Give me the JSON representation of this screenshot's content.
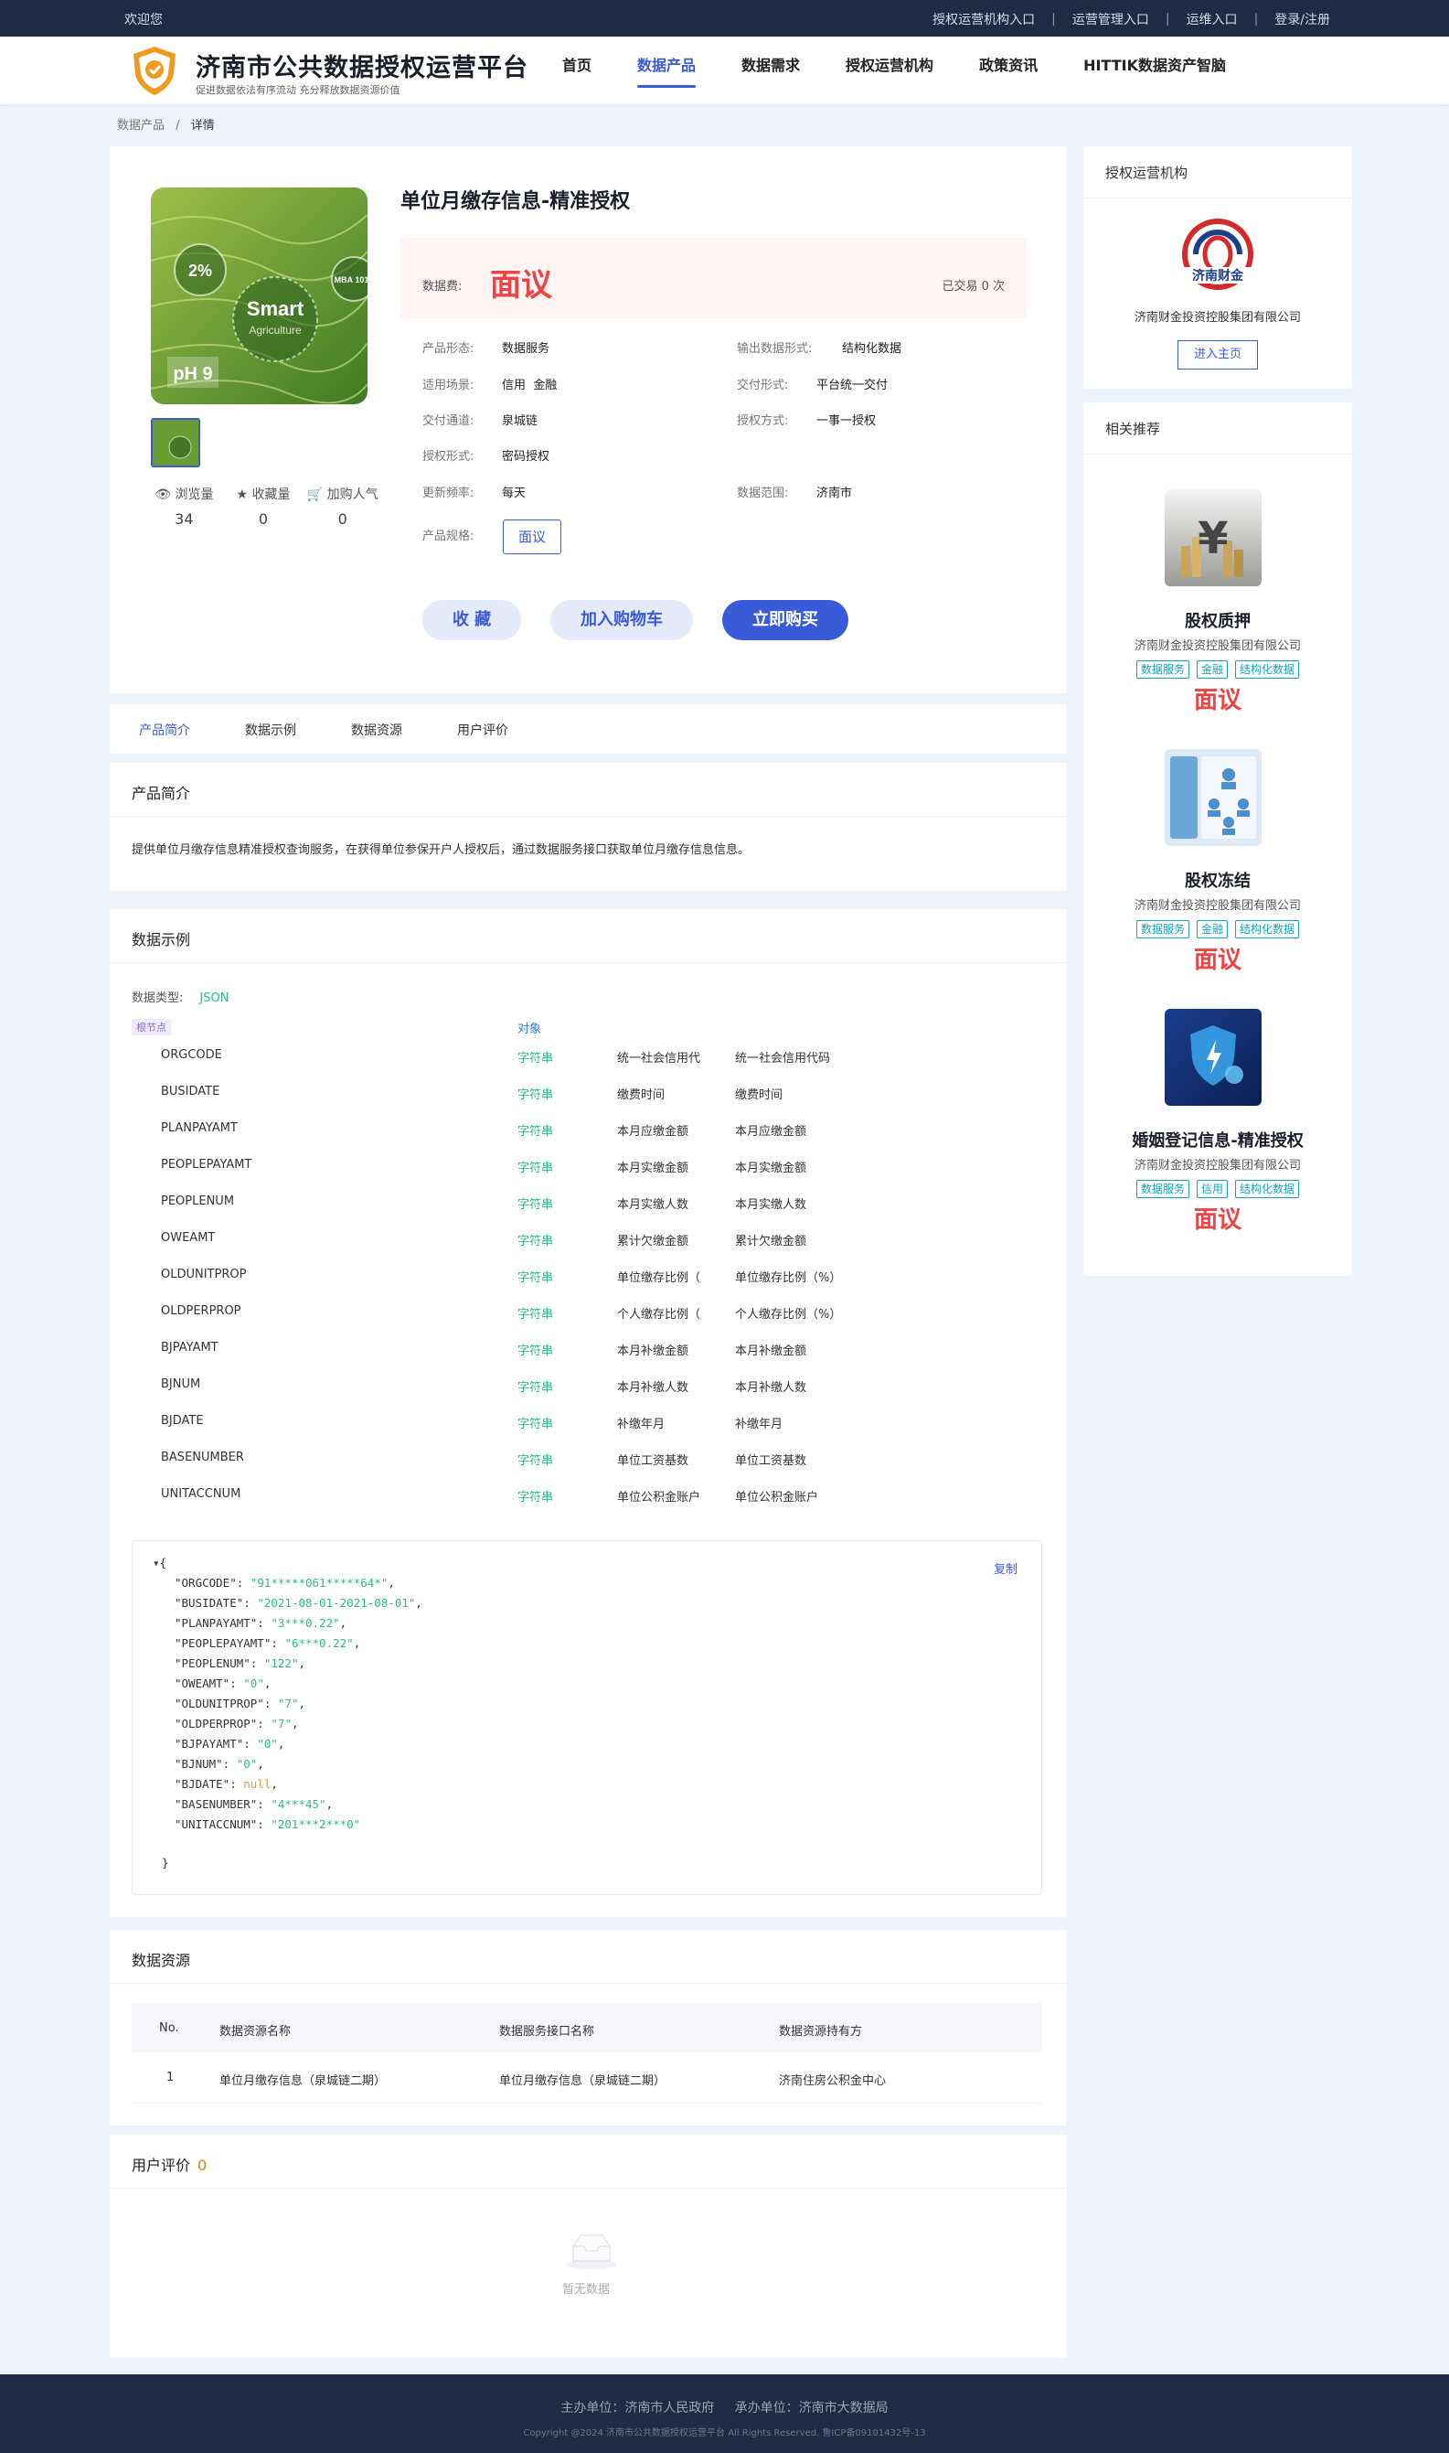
{
  "topbar": {
    "welcome": "欢迎您",
    "links": [
      "授权运营机构入口",
      "运营管理入口",
      "运维入口",
      "登录/注册"
    ]
  },
  "header": {
    "title": "济南市公共数据授权运营平台",
    "subtitle": "促进数据依法有序流动 充分释放数据资源价值",
    "nav": [
      "首页",
      "数据产品",
      "数据需求",
      "授权运营机构",
      "政策资讯",
      "HITTIK数据资产智脑"
    ],
    "active_nav": "数据产品"
  },
  "breadcrumb": {
    "parent": "数据产品",
    "sep": "/",
    "current": "详情"
  },
  "product": {
    "image_texts": {
      "pct": "2%",
      "smart": "Smart",
      "agri": "Agriculture",
      "ph": "pH 9",
      "mba": "MBA 1010"
    },
    "title": "单位月缴存信息-精准授权",
    "price_label": "数据费:",
    "price": "面议",
    "traded": "已交易 0 次",
    "stats": [
      {
        "label": "浏览量",
        "value": "34",
        "icon": "eye-icon"
      },
      {
        "label": "收藏量",
        "value": "0",
        "icon": "star-icon"
      },
      {
        "label": "加购人气",
        "value": "0",
        "icon": "cart-icon"
      }
    ],
    "attrs": {
      "form_k": "产品形态:",
      "form_v": "数据服务",
      "output_k": "输出数据形式:",
      "output_v": "结构化数据",
      "scene_k": "适用场景:",
      "scene_v": "信用  金融",
      "delivery_k": "交付形式:",
      "delivery_v": "平台统一交付",
      "channel_k": "交付通道:",
      "channel_v": "泉城链",
      "auth_k": "授权方式:",
      "auth_v": "一事一授权",
      "authform_k": "授权形式:",
      "authform_v": "密码授权",
      "freq_k": "更新频率:",
      "freq_v": "每天",
      "range_k": "数据范围:",
      "range_v": "济南市",
      "spec_k": "产品规格:",
      "spec_v": "面议"
    },
    "buttons": {
      "fav": "收 藏",
      "cart": "加入购物车",
      "buy": "立即购买"
    }
  },
  "tabs": [
    "产品简介",
    "数据示例",
    "数据资源",
    "用户评价"
  ],
  "intro": {
    "title": "产品简介",
    "text": "提供单位月缴存信息精准授权查询服务，在获得单位参保开户人授权后，通过数据服务接口获取单位月缴存信息信息。"
  },
  "sample": {
    "title": "数据示例",
    "type_label": "数据类型:",
    "type_value": "JSON",
    "root_tag": "根节点",
    "object_label": "对象",
    "fields": [
      {
        "name": "ORGCODE",
        "type": "字符串",
        "desc1": "统一社会信用代",
        "desc2": "统一社会信用代码"
      },
      {
        "name": "BUSIDATE",
        "type": "字符串",
        "desc1": "缴费时间",
        "desc2": "缴费时间"
      },
      {
        "name": "PLANPAYAMT",
        "type": "字符串",
        "desc1": "本月应缴金额",
        "desc2": "本月应缴金额"
      },
      {
        "name": "PEOPLEPAYAMT",
        "type": "字符串",
        "desc1": "本月实缴金额",
        "desc2": "本月实缴金额"
      },
      {
        "name": "PEOPLENUM",
        "type": "字符串",
        "desc1": "本月实缴人数",
        "desc2": "本月实缴人数"
      },
      {
        "name": "OWEAMT",
        "type": "字符串",
        "desc1": "累计欠缴金额",
        "desc2": "累计欠缴金额"
      },
      {
        "name": "OLDUNITPROP",
        "type": "字符串",
        "desc1": "单位缴存比例（",
        "desc2": "单位缴存比例（%）"
      },
      {
        "name": "OLDPERPROP",
        "type": "字符串",
        "desc1": "个人缴存比例（",
        "desc2": "个人缴存比例（%）"
      },
      {
        "name": "BJPAYAMT",
        "type": "字符串",
        "desc1": "本月补缴金额",
        "desc2": "本月补缴金额"
      },
      {
        "name": "BJNUM",
        "type": "字符串",
        "desc1": "本月补缴人数",
        "desc2": "本月补缴人数"
      },
      {
        "name": "BJDATE",
        "type": "字符串",
        "desc1": "补缴年月",
        "desc2": "补缴年月"
      },
      {
        "name": "BASENUMBER",
        "type": "字符串",
        "desc1": "单位工资基数",
        "desc2": "单位工资基数"
      },
      {
        "name": "UNITACCNUM",
        "type": "字符串",
        "desc1": "单位公积金账户",
        "desc2": "单位公积金账户"
      }
    ],
    "copy_label": "复制",
    "json_open": "▾{",
    "json_close": "}",
    "json_lines": [
      {
        "key": "\"ORGCODE\": ",
        "val": "\"91*****061*****64*\"",
        "null": false
      },
      {
        "key": "\"BUSIDATE\": ",
        "val": "\"2021-08-01-2021-08-01\"",
        "null": false
      },
      {
        "key": "\"PLANPAYAMT\": ",
        "val": "\"3***0.22\"",
        "null": false
      },
      {
        "key": "\"PEOPLEPAYAMT\": ",
        "val": "\"6***0.22\"",
        "null": false
      },
      {
        "key": "\"PEOPLENUM\": ",
        "val": "\"122\"",
        "null": false
      },
      {
        "key": "\"OWEAMT\": ",
        "val": "\"0\"",
        "null": false
      },
      {
        "key": "\"OLDUNITPROP\": ",
        "val": "\"7\"",
        "null": false
      },
      {
        "key": "\"OLDPERPROP\": ",
        "val": "\"7\"",
        "null": false
      },
      {
        "key": "\"BJPAYAMT\": ",
        "val": "\"0\"",
        "null": false
      },
      {
        "key": "\"BJNUM\": ",
        "val": "\"0\"",
        "null": false
      },
      {
        "key": "\"BJDATE\": ",
        "val": "null",
        "null": true
      },
      {
        "key": "\"BASENUMBER\": ",
        "val": "\"4***45\"",
        "null": false
      },
      {
        "key": "\"UNITACCNUM\": ",
        "val": "\"201***2***0\"",
        "null": false
      }
    ]
  },
  "resources": {
    "title": "数据资源",
    "headers": [
      "No.",
      "数据资源名称",
      "数据服务接口名称",
      "数据资源持有方"
    ],
    "rows": [
      [
        "1",
        "单位月缴存信息（泉城链二期）",
        "单位月缴存信息（泉城链二期）",
        "济南住房公积金中心"
      ]
    ]
  },
  "evaluation": {
    "title": "用户评价",
    "count": "0",
    "empty": "暂无数据"
  },
  "side_org": {
    "title": "授权运营机构",
    "logo_text": "济南财金",
    "name": "济南财金投资控股集团有限公司",
    "button": "进入主页"
  },
  "side_rec": {
    "title": "相关推荐",
    "items": [
      {
        "name": "股权质押",
        "company": "济南财金投资控股集团有限公司",
        "tags": [
          "数据服务",
          "金融",
          "结构化数据"
        ],
        "price": "面议"
      },
      {
        "name": "股权冻结",
        "company": "济南财金投资控股集团有限公司",
        "tags": [
          "数据服务",
          "金融",
          "结构化数据"
        ],
        "price": "面议"
      },
      {
        "name": "婚姻登记信息-精准授权",
        "company": "济南财金投资控股集团有限公司",
        "tags": [
          "数据服务",
          "信用",
          "结构化数据"
        ],
        "price": "面议"
      }
    ]
  },
  "footer": {
    "line1": "主办单位：济南市人民政府     承办单位：济南市大数据局",
    "line2": "Copyright @2024 济南市公共数据授权运营平台 All Rights Reserved. 鲁ICP备09101432号-13"
  },
  "colors": {
    "accent": "#3a5bd8",
    "price": "#ef4343",
    "string_type": "#2dbb82",
    "dark_bar": "#1f2a44"
  }
}
